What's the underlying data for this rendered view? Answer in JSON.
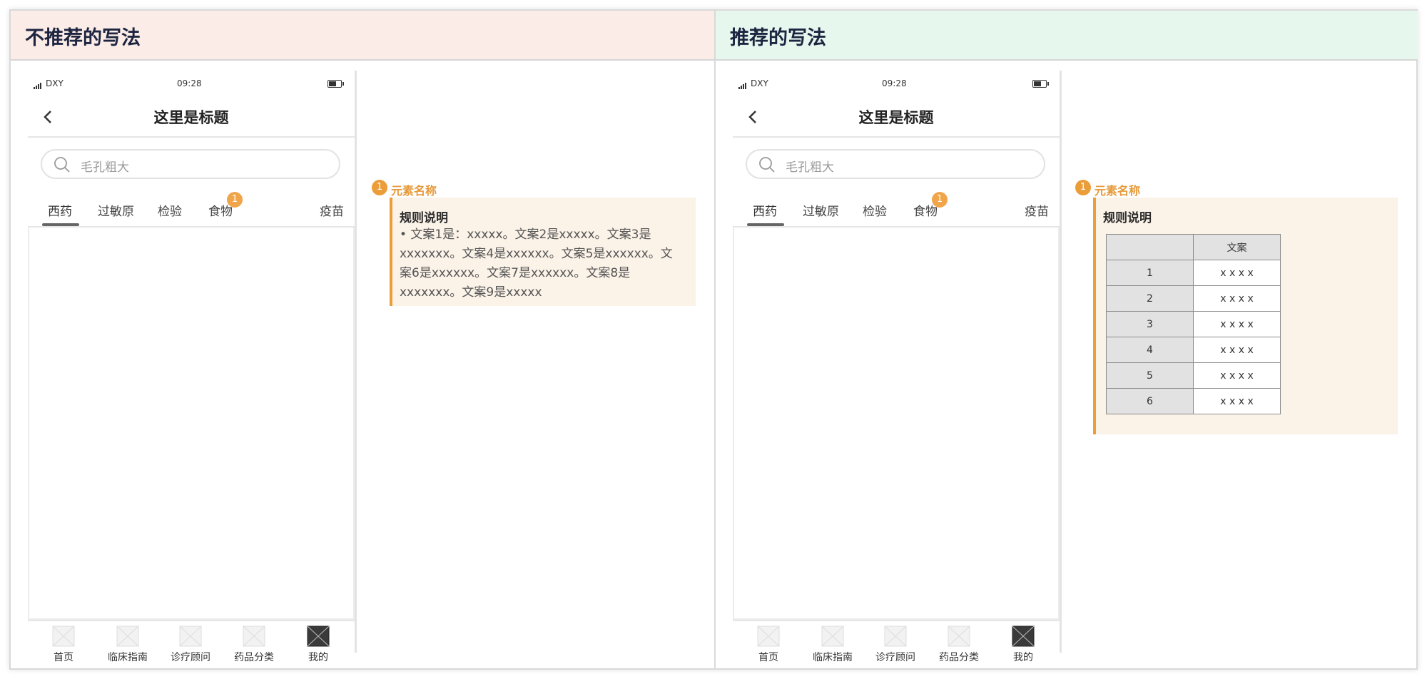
{
  "panels": {
    "bad": {
      "title": "不推荐的写法"
    },
    "good": {
      "title": "推荐的写法"
    }
  },
  "phone": {
    "carrier": "DXY",
    "time": "09:28",
    "nav_title": "这里是标题",
    "search_placeholder": "毛孔粗大",
    "tabs": [
      "西药",
      "过敏原",
      "检验",
      "食物",
      "疫苗"
    ],
    "active_tab": "西药",
    "tab_badge": "1",
    "tabbar": [
      "首页",
      "临床指南",
      "诊疗顾问",
      "药品分类",
      "我的"
    ],
    "active_tabbar": "我的"
  },
  "annotation_bad": {
    "number": "1",
    "name": "元素名称",
    "title": "规则说明",
    "body_lines": [
      "• 文案1是：xxxxx。文案2是xxxxx。文案3是",
      "xxxxxxx。文案4是xxxxxx。文案5是xxxxxx。文",
      "案6是xxxxxx。文案7是xxxxxx。文案8是",
      "xxxxxxx。文案9是xxxxx"
    ]
  },
  "annotation_good": {
    "number": "1",
    "name": "元素名称",
    "title": "规则说明",
    "table": {
      "header": [
        "",
        "文案"
      ],
      "rows": [
        [
          "1",
          "x x x x"
        ],
        [
          "2",
          "x x x x"
        ],
        [
          "3",
          "x x x x"
        ],
        [
          "4",
          "x x x x"
        ],
        [
          "5",
          "x x x x"
        ],
        [
          "6",
          "x x x x"
        ]
      ]
    }
  },
  "colors": {
    "bad_header": "#fbece7",
    "good_header": "#e6f8ee",
    "accent": "#eb9d39",
    "annotation_bg": "#fbf2e8"
  }
}
